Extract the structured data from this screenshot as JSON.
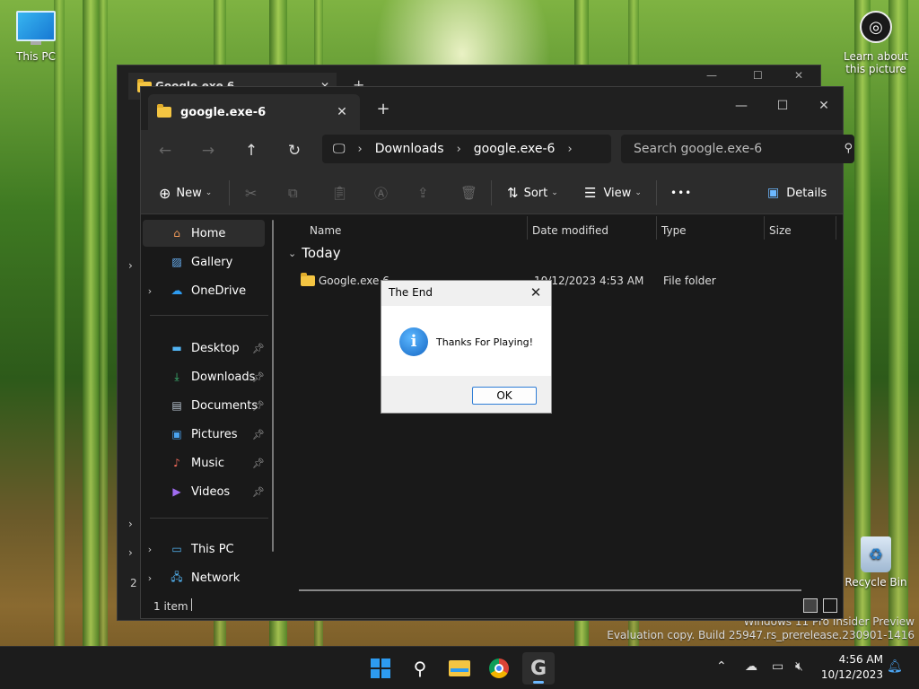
{
  "desktop": {
    "this_pc_label": "This PC",
    "learn_label_1": "Learn about",
    "learn_label_2": "this picture",
    "recycle_label": "Recycle Bin",
    "watermark_line1": "Windows 11 Pro Insider Preview",
    "watermark_line2": "Evaluation copy. Build 25947.rs_prerelease.230901-1416"
  },
  "back_window": {
    "tab_label": "Google.exe 6",
    "status_text": "2 i"
  },
  "window": {
    "tab_label": "google.exe-6",
    "tab_close": "✕",
    "new_tab": "+",
    "minimize": "—",
    "maximize": "☐",
    "close": "✕"
  },
  "navbar": {
    "back": "←",
    "forward": "→",
    "up": "↑",
    "refresh": "↻",
    "breadcrumb": [
      "Downloads",
      "google.exe-6"
    ],
    "search_placeholder": "Search google.exe-6"
  },
  "toolbar": {
    "new_label": "New",
    "sort_label": "Sort",
    "view_label": "View",
    "more_label": "•••",
    "details_label": "Details"
  },
  "sidebar": {
    "home": "Home",
    "gallery": "Gallery",
    "onedrive": "OneDrive",
    "desktop": "Desktop",
    "downloads": "Downloads",
    "documents": "Documents",
    "pictures": "Pictures",
    "music": "Music",
    "videos": "Videos",
    "this_pc": "This PC",
    "network": "Network"
  },
  "content": {
    "columns": [
      "Name",
      "Date modified",
      "Type",
      "Size"
    ],
    "group_label": "Today",
    "rows": [
      {
        "name": "Google.exe 6",
        "date": "10/12/2023 4:53 AM",
        "type": "File folder",
        "size": ""
      }
    ]
  },
  "status": {
    "count": "1 item"
  },
  "dialog": {
    "title": "The End",
    "message": "Thanks For Playing!",
    "ok_label": "OK",
    "close": "✕",
    "icon_glyph": "i"
  },
  "taskbar": {
    "time": "4:56 AM",
    "date": "10/12/2023",
    "g_letter": "G"
  },
  "colors": {
    "accent": "#2d9bf0",
    "dialog_button_border": "#2e7dd6",
    "folder": "#f4c542"
  }
}
